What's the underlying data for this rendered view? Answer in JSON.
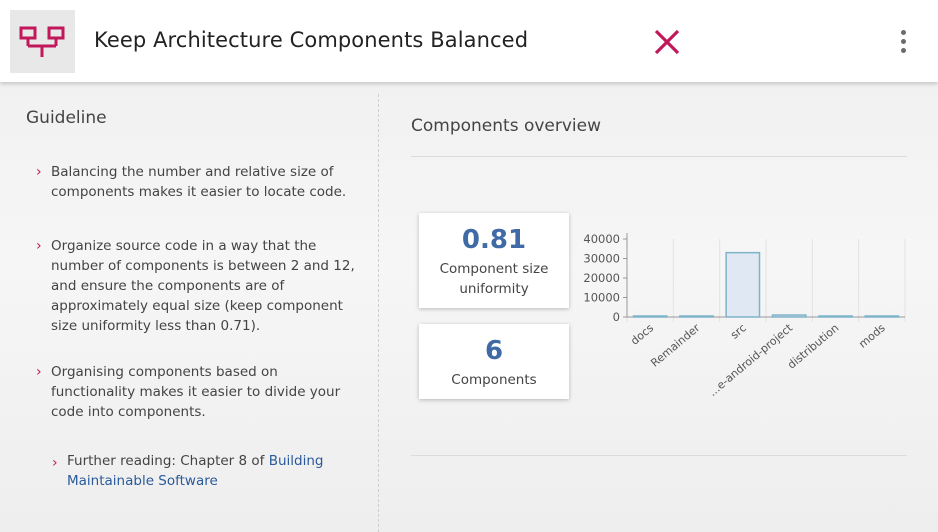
{
  "header": {
    "title": "Keep Architecture Components Balanced",
    "logo_icon": "component-diagram-icon",
    "close_icon": "close-icon",
    "menu_icon": "more-vertical-icon",
    "accent_color": "#c2185b"
  },
  "guideline": {
    "heading": "Guideline",
    "items": [
      "Balancing the number and relative size of components makes it easier to locate code.",
      "Organize source code in a way that the number of components is between 2 and 12, and ensure the components are of approximately equal size (keep component size uniformity less than 0.71).",
      "Organising components based on functionality makes it easier to divide your code into components."
    ],
    "further_reading_prefix": "Further reading: Chapter 8 of ",
    "further_reading_link": "Building Maintainable Software"
  },
  "overview": {
    "heading": "Components overview",
    "metrics": [
      {
        "value": "0.81",
        "label": "Component size uniformity"
      },
      {
        "value": "6",
        "label": "Components"
      }
    ]
  },
  "chart_data": {
    "type": "bar",
    "categories": [
      "docs",
      "Remainder",
      "src",
      "...e-android-project",
      "distribution",
      "mods"
    ],
    "values": [
      200,
      100,
      33000,
      1000,
      150,
      100
    ],
    "ylim": [
      0,
      40000
    ],
    "yticks": [
      "0",
      "10000",
      "20000",
      "30000",
      "40000"
    ],
    "grid": true,
    "bar_fill": "#dfe8f3",
    "bar_stroke": "#7fb3c9"
  }
}
